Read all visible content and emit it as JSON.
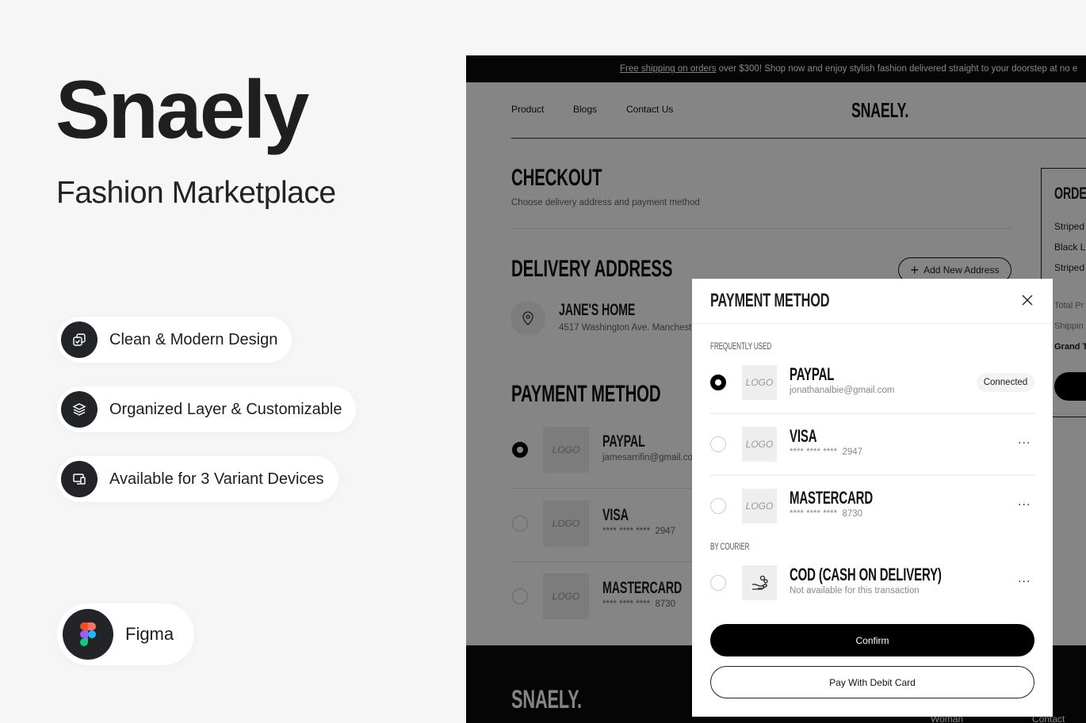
{
  "promo": {
    "title": "Snaely",
    "subtitle": "Fashion Marketplace",
    "features": [
      {
        "label": "Clean & Modern Design",
        "icon": "copy-check-icon"
      },
      {
        "label": "Organized Layer & Customizable",
        "icon": "layers-icon"
      },
      {
        "label": "Available for 3 Variant Devices",
        "icon": "devices-icon"
      }
    ],
    "tool": {
      "label": "Figma",
      "icon": "figma-icon"
    }
  },
  "page": {
    "banner": {
      "link": "Free shipping on orders",
      "text": " over $300! Shop now and enjoy stylish fashion delivered straight to your doorstep at no e"
    },
    "nav": [
      "Product",
      "Blogs",
      "Contact Us"
    ],
    "brand": "SNAELY.",
    "checkout": {
      "title": "CHECKOUT",
      "subtitle": "Choose delivery address and payment method"
    },
    "delivery": {
      "title": "DELIVERY ADDRESS",
      "add_button": "Add New Address",
      "address_name": "JANE'S HOME",
      "address_line": "4517 Washington Ave. Mancheste"
    },
    "payment": {
      "title": "PAYMENT METHOD",
      "items": [
        {
          "name": "PAYPAL",
          "detail": "jamesarrifin@gmail.co",
          "logo": "LOGO",
          "selected": true
        },
        {
          "name": "VISA",
          "detail": "**** **** ****  2947",
          "logo": "LOGO",
          "selected": false
        },
        {
          "name": "MASTERCARD",
          "detail": "**** **** ****  8730",
          "logo": "LOGO",
          "selected": false
        }
      ]
    },
    "order": {
      "title": "ORDER",
      "items": [
        "Striped",
        "Black L",
        "Striped"
      ],
      "total": "Total Pr",
      "shipping": "Shippin",
      "grand": "Grand T"
    },
    "footer": {
      "brand": "SNAELY.",
      "links": [
        "Woman",
        "Contact"
      ]
    }
  },
  "modal": {
    "title": "PAYMENT METHOD",
    "sections": [
      {
        "label": "FREQUENTLY USED",
        "items": [
          {
            "name": "PAYPAL",
            "detail": "jonathanalbie@gmail.com",
            "logo": "LOGO",
            "selected": true,
            "badge": "Connected"
          },
          {
            "name": "VISA",
            "detail": "**** **** ****  2947",
            "logo": "LOGO",
            "selected": false,
            "more": "..."
          },
          {
            "name": "MASTERCARD",
            "detail": "**** **** ****  8730",
            "logo": "LOGO",
            "selected": false,
            "more": "..."
          }
        ]
      },
      {
        "label": "BY COURIER",
        "items": [
          {
            "name": "COD (CASH ON DELIVERY)",
            "detail": "Not available for this transaction",
            "icon": "hand-coins-icon",
            "selected": false,
            "more": "..."
          }
        ]
      }
    ],
    "confirm": "Confirm",
    "debit": "Pay With Debit Card"
  }
}
